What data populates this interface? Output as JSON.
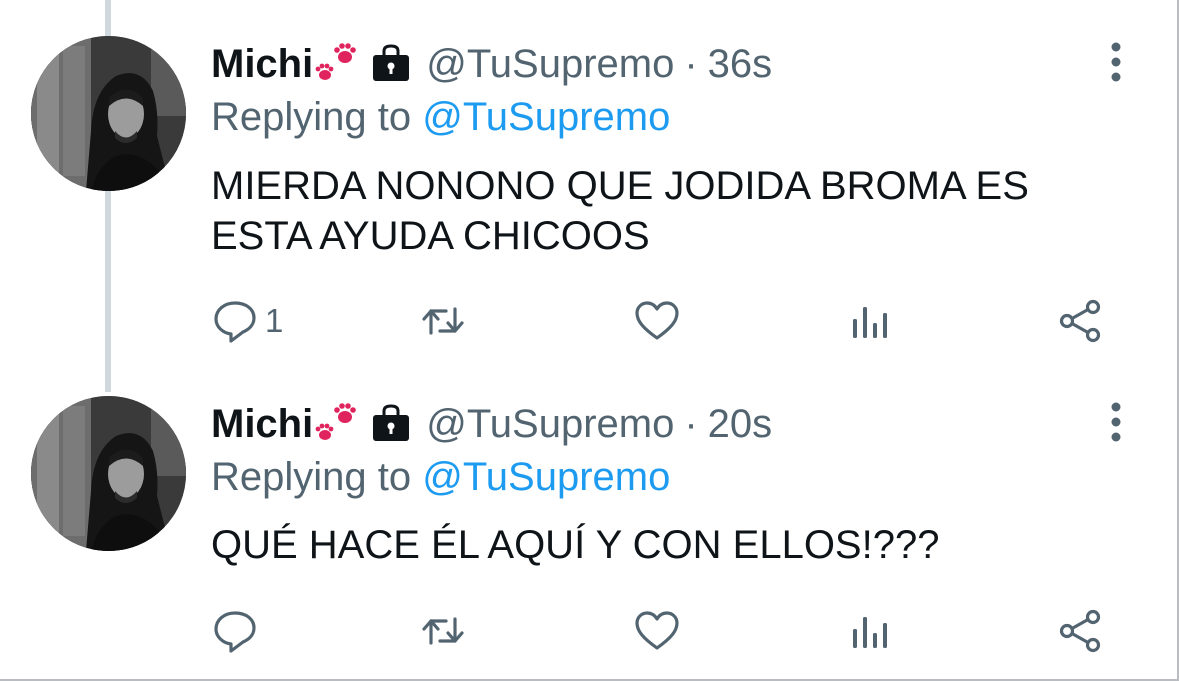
{
  "tweets": [
    {
      "author": {
        "name": "Michi",
        "handle": "@TuSupremo",
        "badge_icons": [
          "paw-prints-emoji",
          "lock-icon"
        ]
      },
      "separator": "·",
      "timestamp": "36s",
      "replying": {
        "prefix": "Replying to",
        "mention": "@TuSupremo"
      },
      "text": "MIERDA NONONO QUE JODIDA BROMA ES ESTA AYUDA CHICOOS",
      "actions": {
        "reply_count": "1",
        "retweet_count": "",
        "like_count": ""
      }
    },
    {
      "author": {
        "name": "Michi",
        "handle": "@TuSupremo",
        "badge_icons": [
          "paw-prints-emoji",
          "lock-icon"
        ]
      },
      "separator": "·",
      "timestamp": "20s",
      "replying": {
        "prefix": "Replying to",
        "mention": "@TuSupremo"
      },
      "text": "QUÉ HACE ÉL AQUÍ Y CON ELLOS!???",
      "actions": {
        "reply_count": "",
        "retweet_count": "",
        "like_count": ""
      }
    }
  ],
  "colors": {
    "text": "#0f1419",
    "secondary": "#536471",
    "link": "#1d9bf0",
    "thread_line": "#cfd9de",
    "paw": "#e0245e"
  }
}
